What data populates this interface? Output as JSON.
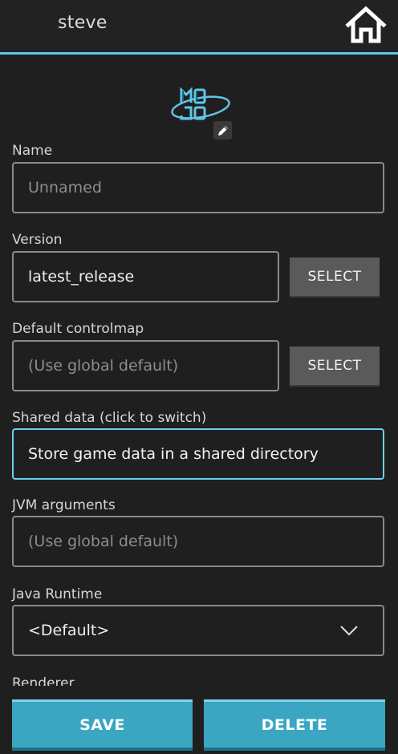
{
  "header": {
    "title": "steve",
    "home_icon": "home-icon"
  },
  "logo": {
    "text_top": "MO",
    "text_bottom": "JO",
    "accent_color": "#5fc6e6",
    "edit_icon": "pencil-icon"
  },
  "form": {
    "name": {
      "label": "Name",
      "placeholder": "Unnamed"
    },
    "version": {
      "label": "Version",
      "value": "latest_release",
      "button": "SELECT"
    },
    "controlmap": {
      "label": "Default controlmap",
      "placeholder": "(Use global default)",
      "button": "SELECT"
    },
    "shared_data": {
      "label": "Shared data (click to switch)",
      "value": "Store game data in a shared directory"
    },
    "jvm_args": {
      "label": "JVM arguments",
      "placeholder": "(Use global default)"
    },
    "java_runtime": {
      "label": "Java Runtime",
      "value": "<Default>"
    },
    "renderer": {
      "label": "Renderer"
    }
  },
  "actions": {
    "save": "SAVE",
    "delete": "DELETE"
  },
  "colors": {
    "accent": "#5fc6e6",
    "button": "#3aa6c2",
    "background": "#1f1f1f"
  }
}
